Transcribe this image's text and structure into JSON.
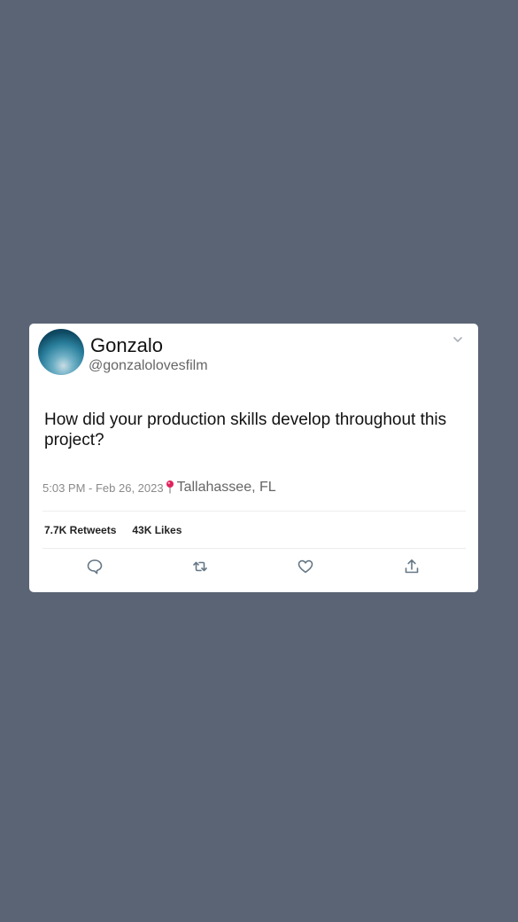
{
  "tweet": {
    "display_name": "Gonzalo",
    "handle": "@gonzalolovesfilm",
    "text": "How did your production skills develop throughout this project?",
    "timestamp": "5:03 PM - Feb 26, 2023",
    "location": "Tallahassee, FL",
    "retweets": "7.7K Retweets",
    "likes": "43K Likes"
  },
  "icons": {
    "menu": "chevron-down-icon",
    "location": "location-pin-icon",
    "reply": "reply-icon",
    "retweet": "retweet-icon",
    "like": "heart-icon",
    "share": "share-icon"
  },
  "colors": {
    "background": "#5b6475",
    "card": "#ffffff",
    "pin": "#e0245e"
  }
}
